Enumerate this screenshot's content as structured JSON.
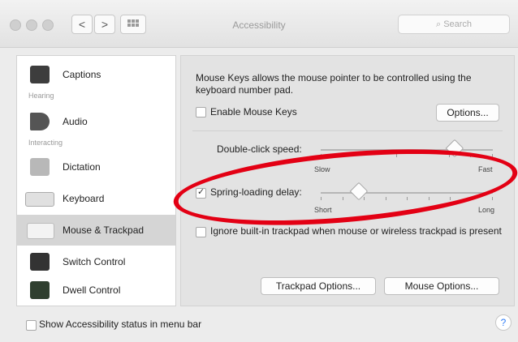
{
  "window": {
    "title": "Accessibility",
    "search_placeholder": "Search"
  },
  "nav": {
    "back": "<",
    "forward": ">"
  },
  "sidebar": {
    "headers": {
      "hearing": "Hearing",
      "interacting": "Interacting"
    },
    "items": [
      {
        "label": "Captions"
      },
      {
        "label": "Audio"
      },
      {
        "label": "Dictation"
      },
      {
        "label": "Keyboard"
      },
      {
        "label": "Mouse & Trackpad",
        "selected": true
      },
      {
        "label": "Switch Control"
      },
      {
        "label": "Dwell Control"
      }
    ]
  },
  "main": {
    "description": "Mouse Keys allows the mouse pointer to be controlled using the keyboard number pad.",
    "enable_mouse_keys": {
      "label": "Enable Mouse Keys",
      "checked": false
    },
    "options_button": "Options...",
    "double_click": {
      "label": "Double-click speed:",
      "min_label": "Slow",
      "max_label": "Fast",
      "value": 0.78
    },
    "spring_loading": {
      "label": "Spring-loading delay:",
      "checked": true,
      "min_label": "Short",
      "max_label": "Long",
      "value": 0.22
    },
    "ignore_trackpad": {
      "label": "Ignore built-in trackpad when mouse or wireless trackpad is present",
      "checked": false
    },
    "trackpad_options_button": "Trackpad Options...",
    "mouse_options_button": "Mouse Options..."
  },
  "footer": {
    "status_menu": {
      "label": "Show Accessibility status in menu bar",
      "checked": false
    },
    "help": "?"
  },
  "colors": {
    "annotation": "#e30014",
    "help_accent": "#2e7cf6"
  }
}
